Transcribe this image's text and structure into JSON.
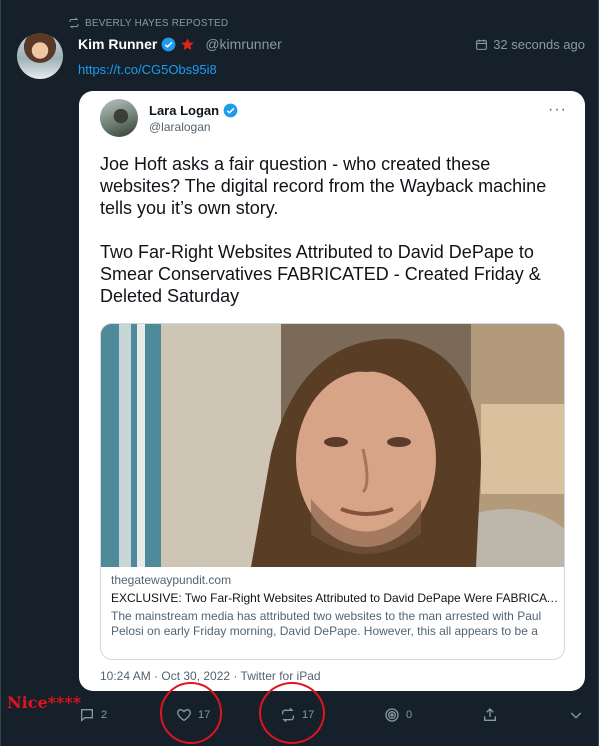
{
  "repost": {
    "label": "BEVERLY HAYES REPOSTED",
    "icon": "repost-icon"
  },
  "post": {
    "author_name": "Kim Runner",
    "author_handle": "@kimrunner",
    "timestamp": "32 seconds ago",
    "link_text": "https://t.co/CG5Obs95i8"
  },
  "embedded": {
    "author_name": "Lara Logan",
    "author_handle": "@laralogan",
    "more": "···",
    "text": "Joe Hoft asks a fair question - who created these websites? The digital record from the Wayback machine tells you it’s own story.\n\nTwo Far-Right Websites Attributed to David DePape to Smear Conservatives FABRICATED - Created Friday & Deleted Saturday",
    "link_card": {
      "domain": "thegatewaypundit.com",
      "title": "EXCLUSIVE: Two Far-Right Websites Attributed to David DePape Were FABRICATED - Created Friday & Deleted Saturday",
      "description": "The mainstream media has attributed two websites to the man arrested with Paul Pelosi on early Friday morning, David DePape.  However, this all appears to be a fabrication."
    },
    "footer_time": "10:24 AM · Oct 30, 2022 · Twitter for iPad"
  },
  "annotation": {
    "text": "Nice****"
  },
  "actions": {
    "reply_count": "2",
    "like_count": "17",
    "repost_count": "17",
    "view_count": "0"
  },
  "colors": {
    "background": "#15202b",
    "accent": "#1d9bf0",
    "muted": "#8899a6",
    "annotation_red": "#e0141e"
  }
}
